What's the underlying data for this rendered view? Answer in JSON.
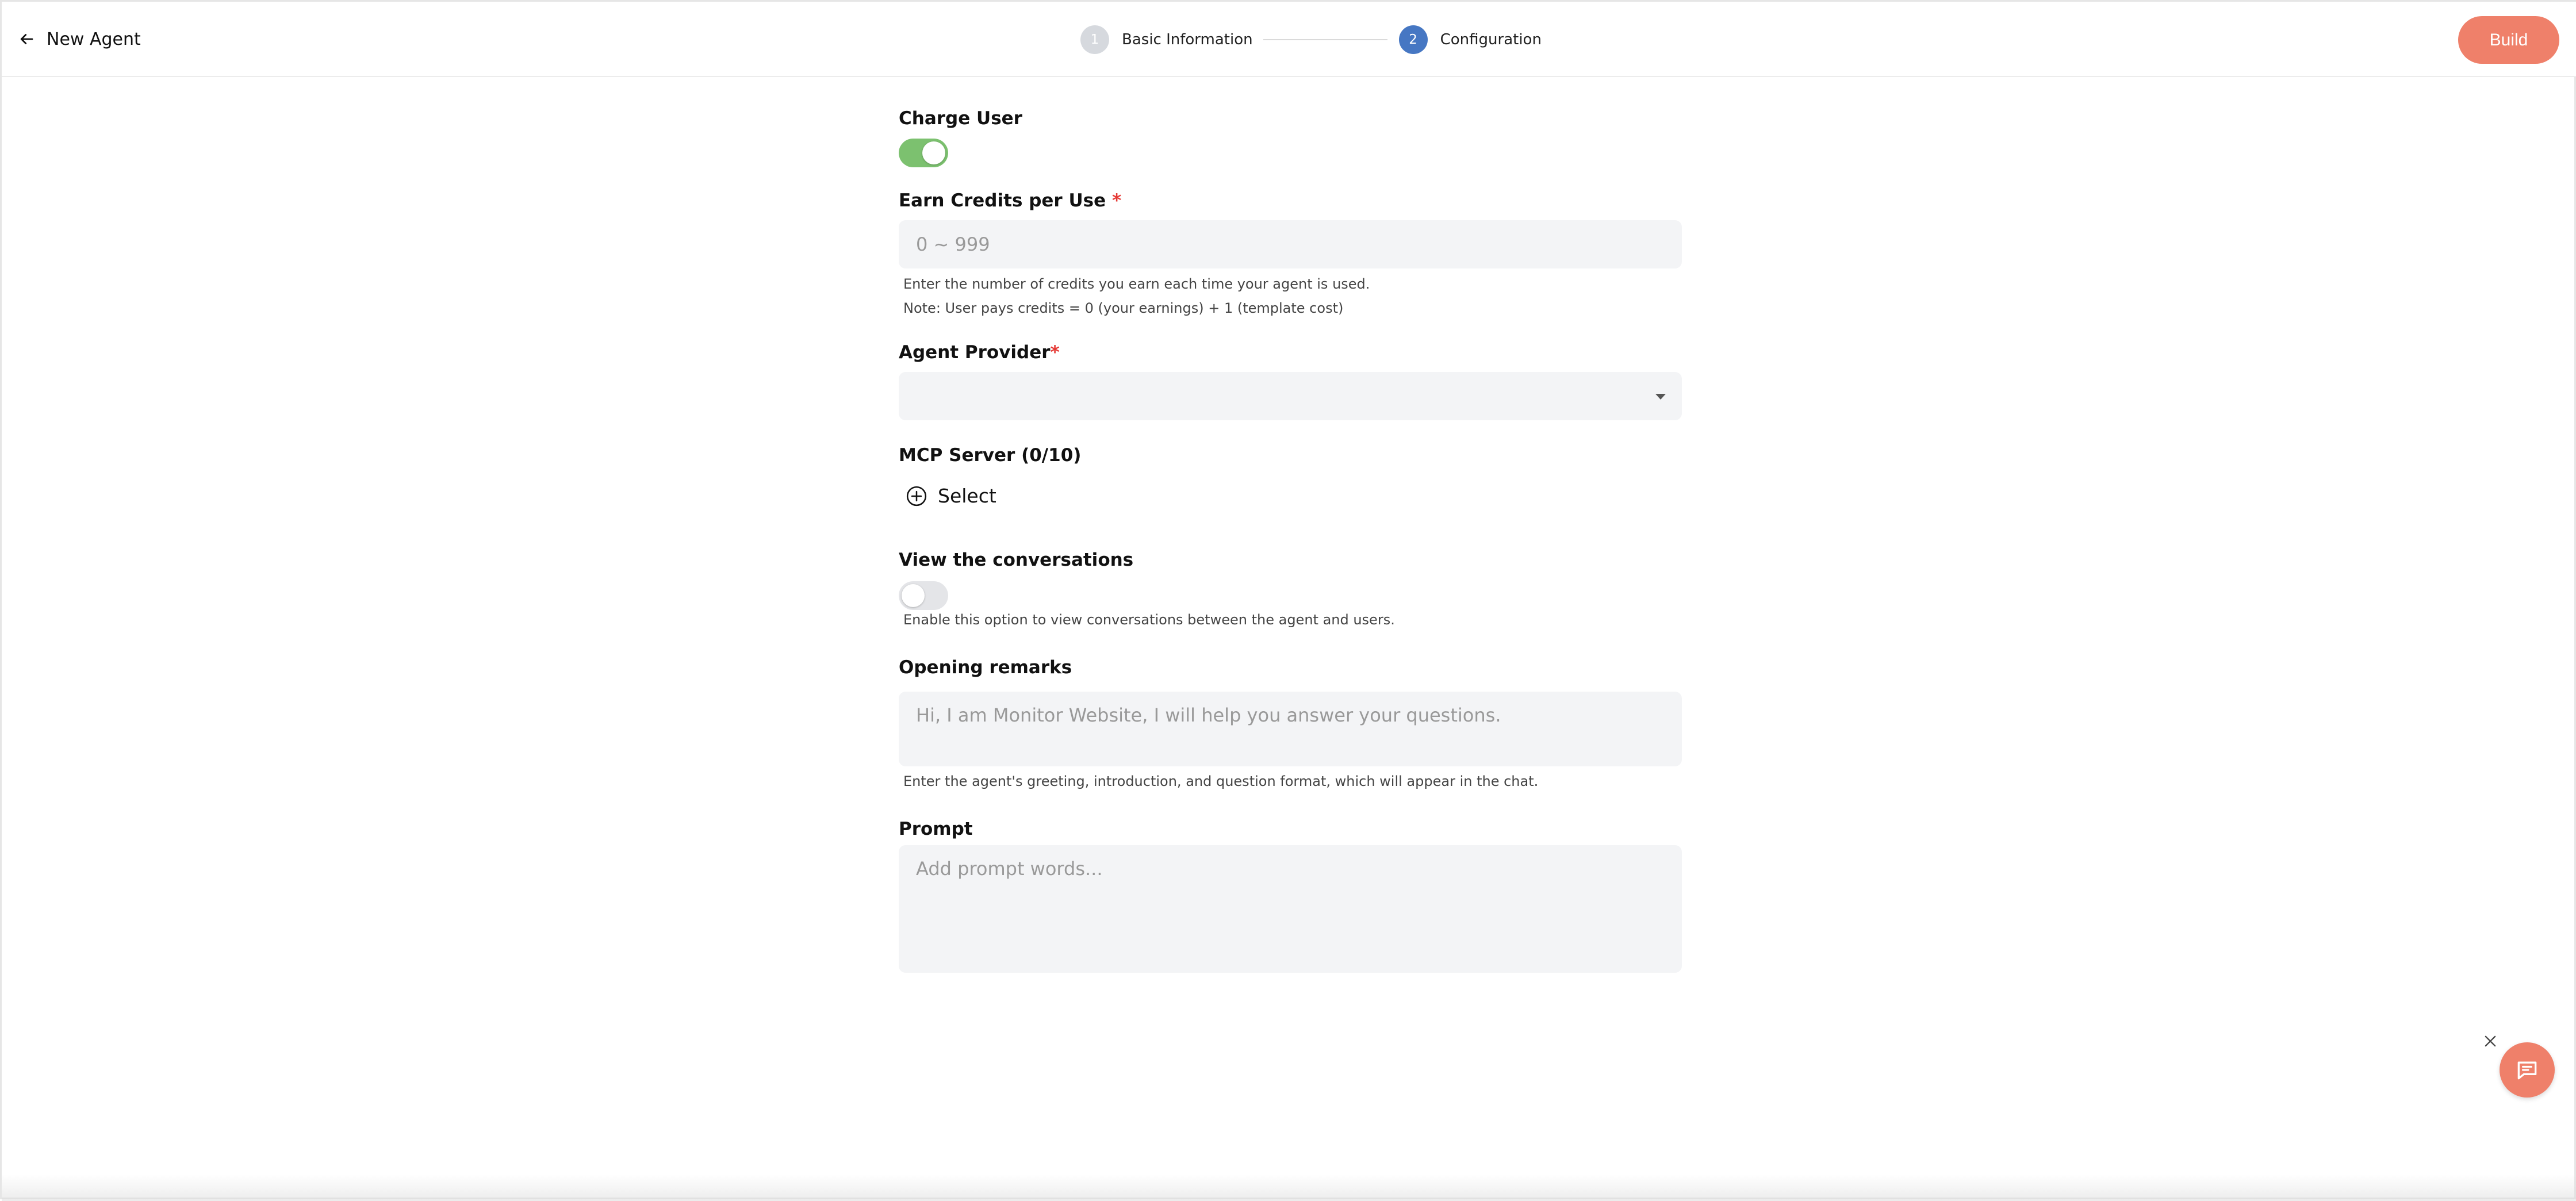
{
  "header": {
    "back_label": "New Agent",
    "steps": [
      {
        "number": "1",
        "label": "Basic Information",
        "state": "done"
      },
      {
        "number": "2",
        "label": "Configuration",
        "state": "active"
      }
    ],
    "build_label": "Build"
  },
  "form": {
    "charge_user": {
      "label": "Charge User",
      "enabled": true
    },
    "earn_credits": {
      "label": "Earn Credits per Use",
      "required_mark": "*",
      "placeholder": "0 ~ 999",
      "hint_1": "Enter the number of credits you earn each time your agent is used.",
      "hint_2": "Note: User pays credits = 0 (your earnings) + 1 (template cost)"
    },
    "agent_provider": {
      "label": "Agent Provider",
      "required_mark": "*",
      "value": ""
    },
    "mcp_server": {
      "label": "MCP Server (0/10)",
      "select_label": "Select"
    },
    "view_conversations": {
      "label": "View the conversations",
      "enabled": false,
      "hint": "Enable this option to view conversations between the agent and users."
    },
    "opening_remarks": {
      "label": "Opening remarks",
      "placeholder": "Hi, I am Monitor Website, I will help you answer your questions.",
      "hint": "Enter the agent's greeting, introduction, and question format, which will appear in the chat."
    },
    "prompt": {
      "label": "Prompt",
      "placeholder": "Add prompt words..."
    }
  },
  "colors": {
    "accent": "#ef806a",
    "step_active": "#4677c3",
    "toggle_on": "#7cc16f",
    "required": "#e53935",
    "field_bg": "#f3f4f6"
  },
  "icons": [
    "arrow-left-icon",
    "plus-circle-icon",
    "caret-down-icon",
    "close-icon",
    "chat-icon"
  ]
}
